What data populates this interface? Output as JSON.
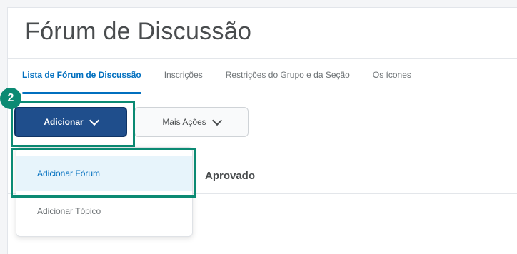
{
  "page": {
    "title": "Fórum de Discussão"
  },
  "tabs": [
    {
      "label": "Lista de Fórum de Discussão",
      "active": true
    },
    {
      "label": "Inscrições",
      "active": false
    },
    {
      "label": "Restrições do Grupo e da Seção",
      "active": false
    },
    {
      "label": "Os ícones",
      "active": false
    }
  ],
  "annotation": {
    "step_number": "2",
    "color": "#0b8a73"
  },
  "toolbar": {
    "add_label": "Adicionar",
    "more_actions_label": "Mais Ações"
  },
  "dropdown": {
    "items": [
      {
        "label": "Adicionar Fórum",
        "highlighted": true
      },
      {
        "label": "Adicionar Tópico",
        "highlighted": false
      }
    ]
  },
  "content": {
    "column_label": "Aprovado"
  },
  "colors": {
    "accent": "#006fbf",
    "primary_button": "#1f4e8c",
    "highlight": "#0b8a73"
  }
}
